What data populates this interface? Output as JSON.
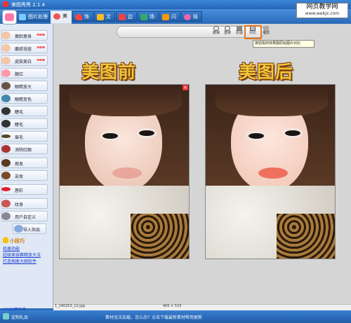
{
  "window": {
    "title": "美图秀秀 2.1.4"
  },
  "watermark": {
    "line1": "网页教学网",
    "line2": "www.webjx.com"
  },
  "tabs": [
    {
      "label": "图片处理",
      "active": false
    },
    {
      "label": "美容",
      "active": true
    },
    {
      "label": "饰品",
      "active": false
    },
    {
      "label": "文字",
      "active": false
    },
    {
      "label": "边框",
      "active": false
    },
    {
      "label": "场景",
      "active": false
    },
    {
      "label": "闪图",
      "active": false
    },
    {
      "label": "娃娃",
      "active": false
    }
  ],
  "sidebar": {
    "items": [
      {
        "label": "瘦脸瘦身",
        "hot": "new",
        "icon": "face-icon"
      },
      {
        "label": "磨皮祛痘",
        "hot": "new",
        "icon": "face-icon"
      },
      {
        "label": "皮肤美白",
        "hot": "new",
        "icon": "face-icon"
      },
      {
        "label": "腮红",
        "hot": "",
        "icon": "blush-icon"
      },
      {
        "label": "眼睛放大",
        "hot": "",
        "icon": "eye-icon"
      },
      {
        "label": "眼睛变色",
        "hot": "",
        "icon": "eye-icon"
      },
      {
        "label": "睫毛",
        "hot": "",
        "icon": "eyelash-icon"
      },
      {
        "label": "睫毛",
        "hot": "",
        "icon": "eyelash-icon"
      },
      {
        "label": "眉毛",
        "hot": "",
        "icon": "eyebrow-icon"
      },
      {
        "label": "消除红眼",
        "hot": "",
        "icon": "eye-icon"
      },
      {
        "label": "假发",
        "hot": "",
        "icon": "hair-icon"
      },
      {
        "label": "染发",
        "hot": "",
        "icon": "hair-icon"
      },
      {
        "label": "唇彩",
        "hot": "",
        "icon": "lips-icon"
      },
      {
        "label": "纹身",
        "hot": "",
        "icon": "tattoo-icon"
      },
      {
        "label": "用户自定义",
        "hot": "",
        "icon": "custom-icon"
      }
    ],
    "import_label": "导入饰品",
    "tips_title": "小技巧",
    "tips": [
      "机器功能",
      "超级美容赛精放大法",
      "打造相册大图软件"
    ],
    "game_link": "4399游戏盒"
  },
  "toolbar": {
    "buttons": [
      "撤销",
      "重做",
      "原图",
      "对比",
      "缩放"
    ],
    "tooltip": "按钮看的效果图原始图片对比"
  },
  "main": {
    "before_title": "美图前",
    "after_title": "美图后",
    "filename": "1_140253_12.jpg",
    "image_size": "400 × 533"
  },
  "statusbar": {
    "left_label": "定制礼品",
    "message": "素材无法加载，怎么办？点击下载最新素材帮用更新"
  },
  "colors": {
    "accent": "#e8741a",
    "title_gold": "#f0c43c",
    "link": "#1a3fd0"
  }
}
